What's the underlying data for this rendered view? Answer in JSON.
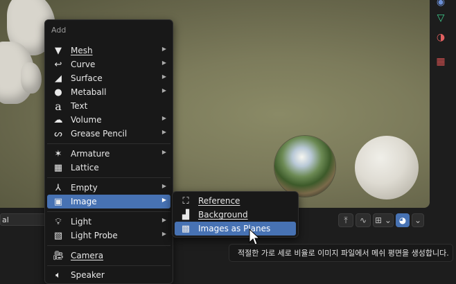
{
  "add_menu": {
    "title": "Add",
    "items": [
      {
        "label": "Mesh",
        "icon": "mesh-icon",
        "submenu": true
      },
      {
        "label": "Curve",
        "icon": "curve-icon",
        "submenu": true
      },
      {
        "label": "Surface",
        "icon": "surface-icon",
        "submenu": true
      },
      {
        "label": "Metaball",
        "icon": "metaball-icon",
        "submenu": true
      },
      {
        "label": "Text",
        "icon": "text-icon",
        "submenu": false
      },
      {
        "label": "Volume",
        "icon": "volume-icon",
        "submenu": true
      },
      {
        "label": "Grease Pencil",
        "icon": "grease-pencil-icon",
        "submenu": true
      },
      {
        "label": "Armature",
        "icon": "armature-icon",
        "submenu": true
      },
      {
        "label": "Lattice",
        "icon": "lattice-icon",
        "submenu": false
      },
      {
        "label": "Empty",
        "icon": "empty-icon",
        "submenu": true
      },
      {
        "label": "Image",
        "icon": "image-icon",
        "submenu": true,
        "selected": true
      },
      {
        "label": "Light",
        "icon": "light-icon",
        "submenu": true
      },
      {
        "label": "Light Probe",
        "icon": "light-probe-icon",
        "submenu": true
      },
      {
        "label": "Camera",
        "icon": "camera-icon",
        "submenu": false
      },
      {
        "label": "Speaker",
        "icon": "speaker-icon",
        "submenu": false
      }
    ]
  },
  "image_submenu": {
    "items": [
      {
        "label": "Reference",
        "icon": "reference-image-icon"
      },
      {
        "label": "Background",
        "icon": "background-image-icon"
      },
      {
        "label": "Images as Planes",
        "icon": "images-as-planes-icon",
        "selected": true
      }
    ]
  },
  "tooltip": {
    "text": "적절한 가로 세로 비율로 이미지 파일에서 메쉬 평면을 생성합니다."
  },
  "bottom_bar": {
    "editor_field": "al"
  },
  "colors": {
    "highlight": "#4772b3",
    "menu_bg": "#181818",
    "viewport_bg": "#7c7b5b"
  }
}
